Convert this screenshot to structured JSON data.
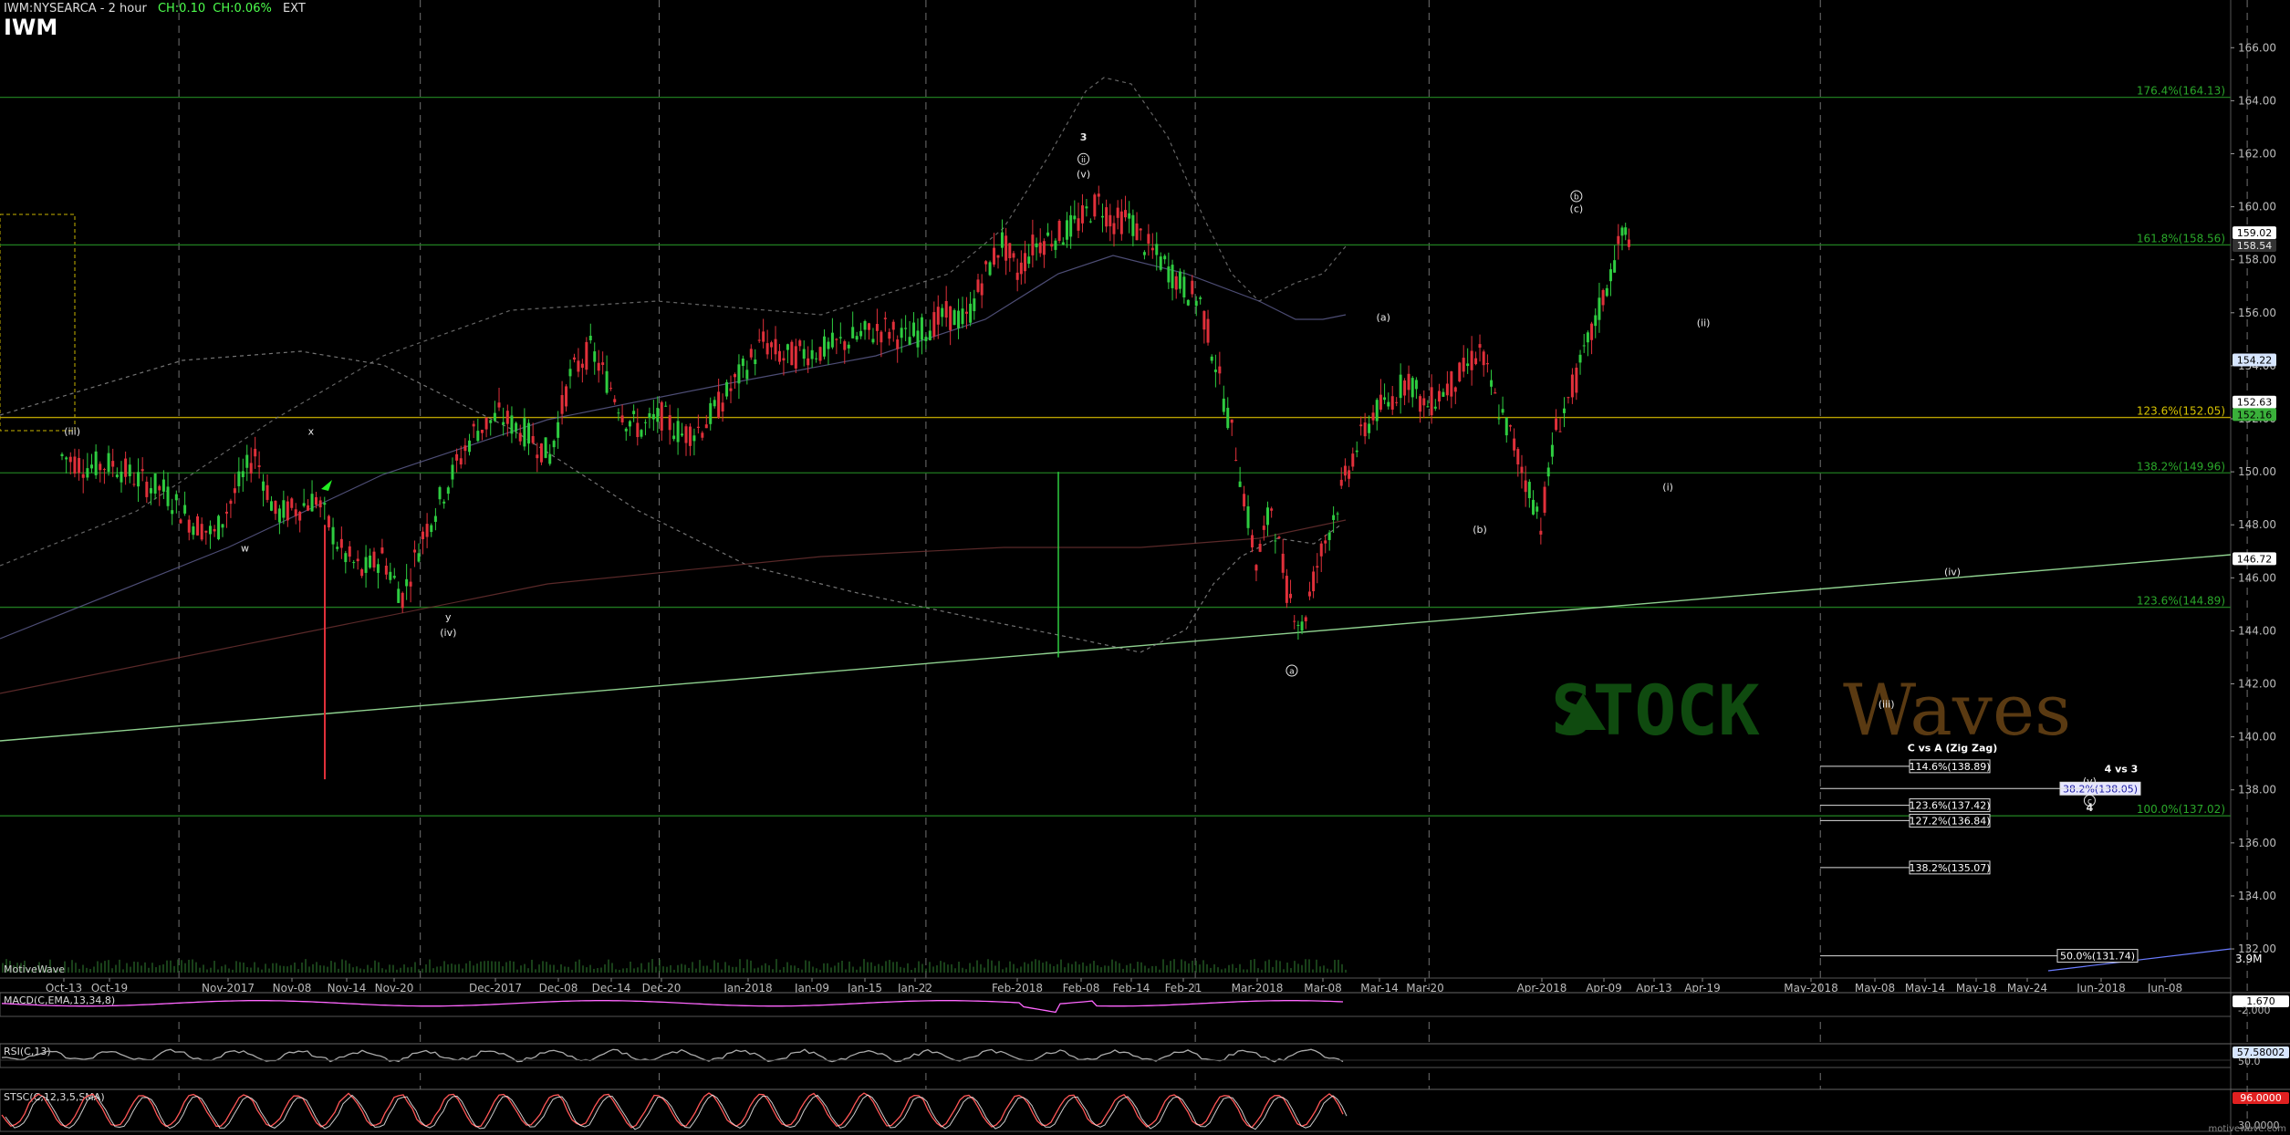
{
  "header": {
    "instrument": "IWM:NYSEARCA - 2 hour",
    "change": "CH:0.10",
    "change_pct": "CH:0.06%",
    "session": "EXT",
    "symbol": "IWM"
  },
  "watermark": {
    "left": "STOCK",
    "right": "Waves"
  },
  "footer": {
    "brand": "MotiveWave",
    "site": "motivewave.com"
  },
  "colors": {
    "background": "#000000",
    "candle_up": "#2ecc40",
    "candle_down": "#e0303a",
    "fib_line": "#1f7a1f",
    "fib_label": "#2aa82a",
    "gold_line": "#b8a000",
    "trendline": "#8fd18f",
    "macd": "#ff66ff",
    "rsi": "#aaaaaa",
    "stoch_k": "#ff5555",
    "stoch_d": "#ffffff"
  },
  "chart_data": {
    "type": "line",
    "x_labels": [
      "Oct-13",
      "Oct-19",
      "Nov-2017",
      "Nov-08",
      "Nov-14",
      "Nov-20",
      "Dec-2017",
      "Dec-08",
      "Dec-14",
      "Dec-20",
      "Jan-2018",
      "Jan-09",
      "Jan-15",
      "Jan-22",
      "Feb-2018",
      "Feb-08",
      "Feb-14",
      "Feb-21",
      "Mar-2018",
      "Mar-08",
      "Mar-14",
      "Mar-20",
      "Apr-2018",
      "Apr-09",
      "Apr-13",
      "Apr-19",
      "May-2018",
      "May-08",
      "May-14",
      "May-18",
      "May-24",
      "Jun-2018",
      "Jun-08"
    ],
    "ylim": [
      130.9,
      167.8
    ],
    "y_ticks": [
      132,
      134,
      136,
      138,
      140,
      142,
      144,
      146,
      148,
      150,
      152,
      154,
      156,
      158,
      160,
      162,
      164,
      166
    ],
    "y_tick_labels": [
      "132.00",
      "134.00",
      "136.00",
      "138.00",
      "140.00",
      "142.00",
      "144.00",
      "146.00",
      "148.00",
      "150.00",
      "152.00",
      "154.00",
      "156.00",
      "158.00",
      "160.00",
      "162.00",
      "164.00",
      "166.00"
    ],
    "price_path": [
      [
        0,
        150.6
      ],
      [
        0.5,
        150.2
      ],
      [
        1,
        150.3
      ],
      [
        1.5,
        149.7
      ],
      [
        2,
        149.3
      ],
      [
        2.5,
        148.2
      ],
      [
        3,
        147.6
      ],
      [
        3.4,
        149.2
      ],
      [
        3.8,
        150.7
      ],
      [
        4.2,
        148.4
      ],
      [
        4.6,
        148.6
      ],
      [
        5,
        149.0
      ],
      [
        5.5,
        147.0
      ],
      [
        5.9,
        146.2
      ],
      [
        6.3,
        146.8
      ],
      [
        6.7,
        145.3
      ],
      [
        7.1,
        147.6
      ],
      [
        7.6,
        149.6
      ],
      [
        8.1,
        151.5
      ],
      [
        8.6,
        152.1
      ],
      [
        9.1,
        151.5
      ],
      [
        9.6,
        150.6
      ],
      [
        10,
        153.6
      ],
      [
        10.4,
        154.6
      ],
      [
        10.8,
        153.2
      ],
      [
        11.1,
        152.0
      ],
      [
        11.4,
        151.6
      ],
      [
        11.8,
        152.1
      ],
      [
        12.2,
        151.4
      ],
      [
        12.6,
        151.7
      ],
      [
        13,
        152.7
      ],
      [
        13.4,
        153.8
      ],
      [
        13.8,
        154.9
      ],
      [
        14.2,
        154.3
      ],
      [
        14.6,
        154.5
      ],
      [
        15,
        154.6
      ],
      [
        15.4,
        154.9
      ],
      [
        15.8,
        155.2
      ],
      [
        16.2,
        155.4
      ],
      [
        16.6,
        155.0
      ],
      [
        17,
        155.4
      ],
      [
        17.4,
        155.9
      ],
      [
        17.8,
        155.7
      ],
      [
        18.1,
        157.2
      ],
      [
        18.5,
        158.7
      ],
      [
        18.8,
        157.5
      ],
      [
        19.1,
        158.5
      ],
      [
        19.4,
        158.8
      ],
      [
        19.7,
        159.0
      ],
      [
        20,
        159.4
      ],
      [
        20.4,
        160.2
      ],
      [
        20.7,
        159.4
      ],
      [
        21,
        159.6
      ],
      [
        21.3,
        158.6
      ],
      [
        21.7,
        157.8
      ],
      [
        22,
        157.1
      ],
      [
        22.4,
        156.4
      ],
      [
        22.7,
        154.1
      ],
      [
        23.1,
        150.8
      ],
      [
        23.5,
        146.5
      ],
      [
        23.8,
        148.7
      ],
      [
        24.1,
        145.6
      ],
      [
        24.4,
        144.1
      ],
      [
        24.7,
        146.5
      ],
      [
        25.1,
        148.8
      ],
      [
        25.4,
        150.6
      ],
      [
        25.8,
        152.2
      ],
      [
        26.1,
        152.6
      ],
      [
        26.5,
        153.6
      ],
      [
        26.8,
        152.4
      ],
      [
        27.1,
        152.9
      ],
      [
        27.5,
        153.6
      ],
      [
        27.9,
        154.6
      ],
      [
        28.2,
        152.7
      ],
      [
        28.5,
        151.4
      ],
      [
        28.8,
        149.7
      ],
      [
        29.1,
        148.1
      ],
      [
        29.4,
        151.6
      ],
      [
        29.8,
        153.5
      ],
      [
        30.1,
        155.2
      ],
      [
        30.4,
        157.0
      ],
      [
        30.7,
        158.9
      ],
      [
        30.9,
        159.0
      ]
    ],
    "current_price": 159.02,
    "right_axis_tags": [
      {
        "label": "159.02",
        "value": 159.02
      },
      {
        "label": "158.54",
        "value": 158.54
      },
      {
        "label": "154.22",
        "value": 154.22
      },
      {
        "label": "152.63",
        "value": 152.63
      },
      {
        "label": "152.16",
        "value": 152.16
      },
      {
        "label": "146.72",
        "value": 146.72
      }
    ],
    "fib_levels": [
      {
        "label": "176.4%(164.13)",
        "value": 164.13
      },
      {
        "label": "161.8%(158.56)",
        "value": 158.56
      },
      {
        "label": "123.6%(152.05)",
        "value": 152.05
      },
      {
        "label": "138.2%(149.96)",
        "value": 149.96
      },
      {
        "label": "123.6%(144.89)",
        "value": 144.89
      },
      {
        "label": "100.0%(137.02)",
        "value": 137.02
      }
    ],
    "target_boxes": [
      {
        "label": "114.6%(138.89)",
        "value": 138.89
      },
      {
        "label": "38.2%(138.05)",
        "value": 138.05
      },
      {
        "label": "123.6%(137.42)",
        "value": 137.42
      },
      {
        "label": "127.2%(136.84)",
        "value": 136.84
      },
      {
        "label": "138.2%(135.07)",
        "value": 135.07
      },
      {
        "label": "50.0%(131.74)",
        "value": 131.74
      }
    ],
    "projection_titles": [
      {
        "label": "C vs A (Zig Zag)",
        "value": 139.6
      },
      {
        "label": "4 vs 3",
        "value": 138.8
      }
    ],
    "wave_labels": [
      {
        "text": "(iii)",
        "x": 0.2,
        "y": 151.4
      },
      {
        "text": "w",
        "x": 3.6,
        "y": 147.0
      },
      {
        "text": "x",
        "x": 4.9,
        "y": 151.4
      },
      {
        "text": "y",
        "x": 7.6,
        "y": 144.4
      },
      {
        "text": "(iv)",
        "x": 7.6,
        "y": 143.8
      },
      {
        "text": "3",
        "x": 20.1,
        "y": 162.5
      },
      {
        "text": "(v)",
        "x": 20.1,
        "y": 161.1
      },
      {
        "text": "(a)",
        "x": 26.0,
        "y": 155.7
      },
      {
        "text": "(b)",
        "x": 27.9,
        "y": 147.7
      },
      {
        "text": "(c)",
        "x": 29.8,
        "y": 159.8
      },
      {
        "text": "(ii)",
        "x": 32.3,
        "y": 155.5
      },
      {
        "text": "(i)",
        "x": 31.6,
        "y": 149.3
      },
      {
        "text": "(iv)",
        "x": 37.2,
        "y": 146.1
      },
      {
        "text": "(iii)",
        "x": 35.9,
        "y": 141.1
      },
      {
        "text": "(v)",
        "x": 39.9,
        "y": 138.2
      },
      {
        "text": "4",
        "x": 39.9,
        "y": 137.2
      }
    ],
    "circle_labels": [
      {
        "text": "ii",
        "x": 20.1,
        "y": 161.8
      },
      {
        "text": "a",
        "x": 24.2,
        "y": 142.5
      },
      {
        "text": "b",
        "x": 29.8,
        "y": 160.4
      },
      {
        "text": "c",
        "x": 39.9,
        "y": 137.6
      }
    ],
    "macd": {
      "label": "MACD(C,EMA,13,34,8)",
      "value_label": "1.670",
      "tick_label": "-2.000"
    },
    "rsi": {
      "label": "RSI(C,13)",
      "value_label": "57.58002",
      "tick_label": "50.0"
    },
    "stoch": {
      "label": "STSC(C,12,3,5,SMA)",
      "value_label": "96.0000",
      "tick_label": "30.0000"
    },
    "volume": {
      "value_label": "3.9M"
    }
  }
}
